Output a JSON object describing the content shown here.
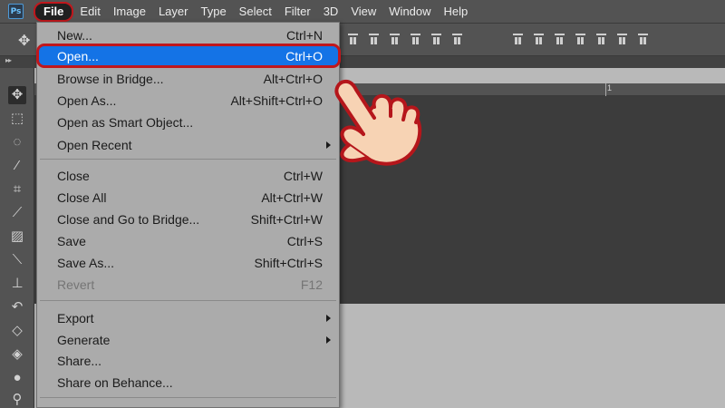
{
  "app": {
    "logo_text": "Ps"
  },
  "menubar": {
    "items": [
      "File",
      "Edit",
      "Image",
      "Layer",
      "Type",
      "Select",
      "Filter",
      "3D",
      "View",
      "Window",
      "Help"
    ]
  },
  "ruler": {
    "mark": "1"
  },
  "file_menu": {
    "items": [
      {
        "label": "New...",
        "shortcut": "Ctrl+N"
      },
      {
        "label": "Open...",
        "shortcut": "Ctrl+O",
        "highlighted": true
      },
      {
        "label": "Browse in Bridge...",
        "shortcut": "Alt+Ctrl+O"
      },
      {
        "label": "Open As...",
        "shortcut": "Alt+Shift+Ctrl+O"
      },
      {
        "label": "Open as Smart Object...",
        "shortcut": ""
      },
      {
        "label": "Open Recent",
        "shortcut": "",
        "submenu": true
      },
      {
        "label": "Close",
        "shortcut": "Ctrl+W"
      },
      {
        "label": "Close All",
        "shortcut": "Alt+Ctrl+W"
      },
      {
        "label": "Close and Go to Bridge...",
        "shortcut": "Shift+Ctrl+W"
      },
      {
        "label": "Save",
        "shortcut": "Ctrl+S"
      },
      {
        "label": "Save As...",
        "shortcut": "Shift+Ctrl+S"
      },
      {
        "label": "Revert",
        "shortcut": "F12",
        "disabled": true
      },
      {
        "label": "Export",
        "shortcut": "",
        "submenu": true
      },
      {
        "label": "Generate",
        "shortcut": "",
        "submenu": true
      },
      {
        "label": "Share...",
        "shortcut": ""
      },
      {
        "label": "Share on Behance...",
        "shortcut": ""
      }
    ]
  },
  "colors": {
    "highlight": "#1473e6",
    "callout_outline": "#c0171c",
    "menu_bg": "#ababab",
    "chrome_bg": "#535353"
  },
  "icons": {
    "toolbar": [
      "move-tool-icon",
      "marquee-tool-icon",
      "lasso-tool-icon",
      "magic-wand-icon",
      "crop-tool-icon",
      "eyedropper-icon",
      "healing-brush-icon",
      "brush-tool-icon",
      "clone-stamp-icon",
      "history-brush-icon",
      "eraser-icon",
      "paint-bucket-icon",
      "blur-tool-icon",
      "dodge-tool-icon"
    ],
    "pointer": "pointing-hand-icon"
  }
}
